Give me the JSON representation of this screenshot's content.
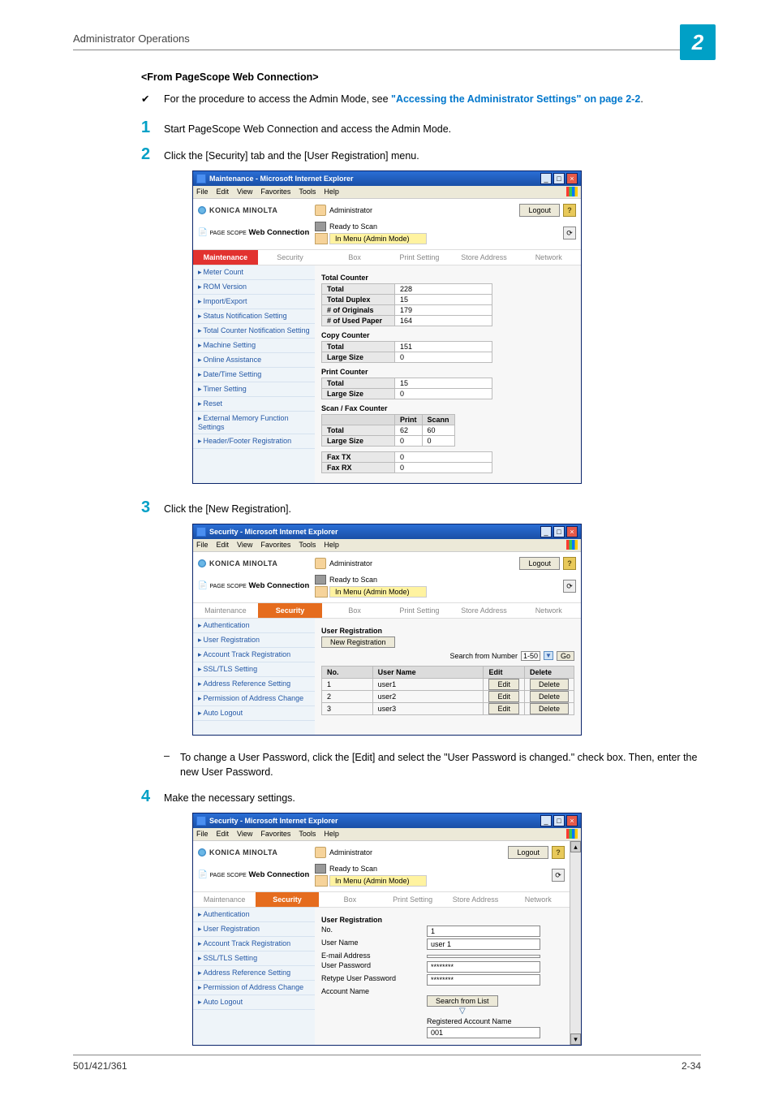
{
  "header": {
    "title": "Administrator Operations",
    "chip": "2"
  },
  "section": {
    "title": "<From PageScope Web Connection>"
  },
  "note": {
    "tick": "✔",
    "pre": "For the procedure to access the Admin Mode, see ",
    "link": "\"Accessing the Administrator Settings\" on page 2-2",
    "post": "."
  },
  "steps": {
    "s1": {
      "num": "1",
      "text": "Start PageScope Web Connection and access the Admin Mode."
    },
    "s2": {
      "num": "2",
      "text": "Click the [Security] tab and the [User Registration] menu."
    },
    "s3": {
      "num": "3",
      "text": "Click the [New Registration]."
    },
    "s3_sub": "To change a User Password, click the [Edit] and select the \"User Password is changed.\" check box. Then, enter the new User Password.",
    "s4": {
      "num": "4",
      "text": "Make the necessary settings."
    }
  },
  "win_common": {
    "brand": "KONICA MINOLTA",
    "role": "Administrator",
    "logout": "Logout",
    "wc": "Web Connection",
    "wc_small": "PAGE SCOPE",
    "status": "Ready to Scan",
    "mode": "In Menu (Admin Mode)",
    "menubar": {
      "file": "File",
      "edit": "Edit",
      "view": "View",
      "fav": "Favorites",
      "tools": "Tools",
      "help": "Help"
    },
    "tabs": {
      "maint": "Maintenance",
      "sec": "Security",
      "box": "Box",
      "print": "Print Setting",
      "store": "Store Address",
      "net": "Network"
    }
  },
  "win1": {
    "title": "Maintenance - Microsoft Internet Explorer",
    "side": [
      "Meter Count",
      "ROM Version",
      "Import/Export",
      "Status Notification Setting",
      "Total Counter Notification Setting",
      "Machine Setting",
      "Online Assistance",
      "Date/Time Setting",
      "Timer Setting",
      "Reset",
      "External Memory Function Settings",
      "Header/Footer Registration"
    ],
    "total_counter": {
      "heading": "Total Counter",
      "rows": [
        [
          "Total",
          "228"
        ],
        [
          "Total Duplex",
          "15"
        ],
        [
          "# of Originals",
          "179"
        ],
        [
          "# of Used Paper",
          "164"
        ]
      ]
    },
    "copy_counter": {
      "heading": "Copy Counter",
      "rows": [
        [
          "Total",
          "151"
        ],
        [
          "Large Size",
          "0"
        ]
      ]
    },
    "print_counter": {
      "heading": "Print Counter",
      "rows": [
        [
          "Total",
          "15"
        ],
        [
          "Large Size",
          "0"
        ]
      ]
    },
    "scanfax": {
      "heading": "Scan / Fax Counter",
      "cols": [
        "",
        "Print",
        "Scann"
      ],
      "rows": [
        [
          "Total",
          "62",
          "60"
        ],
        [
          "Large Size",
          "0",
          "0"
        ]
      ]
    },
    "faxtx": [
      "Fax TX",
      "0"
    ],
    "faxrx": [
      "Fax RX",
      "0"
    ]
  },
  "win2": {
    "title": "Security - Microsoft Internet Explorer",
    "side": [
      "Authentication",
      "User Registration",
      "Account Track Registration",
      "SSL/TLS Setting",
      "Address Reference Setting",
      "Permission of Address Change",
      "Auto Logout"
    ],
    "heading": "User Registration",
    "new_btn": "New Registration",
    "search_lbl": "Search from Number",
    "search_range": "1-50",
    "go": "Go",
    "table": {
      "cols": [
        "No.",
        "User Name",
        "Edit",
        "Delete"
      ],
      "rows": [
        [
          "1",
          "user1",
          "Edit",
          "Delete"
        ],
        [
          "2",
          "user2",
          "Edit",
          "Delete"
        ],
        [
          "3",
          "user3",
          "Edit",
          "Delete"
        ]
      ]
    }
  },
  "win3": {
    "title": "Security - Microsoft Internet Explorer",
    "side": [
      "Authentication",
      "User Registration",
      "Account Track Registration",
      "SSL/TLS Setting",
      "Address Reference Setting",
      "Permission of Address Change",
      "Auto Logout"
    ],
    "heading": "User Registration",
    "fields": {
      "no_lbl": "No.",
      "no_val": "1",
      "un_lbl": "User Name",
      "un_val": "user 1",
      "em_lbl": "E-mail Address",
      "em_val": "",
      "pw_lbl": "User Password",
      "pw_val": "********",
      "rpw_lbl": "Retype User Password",
      "rpw_val": "********",
      "an_lbl": "Account Name",
      "search_btn": "Search from List",
      "ran_lbl": "Registered Account Name",
      "ran_val": "001"
    }
  },
  "footer": {
    "left": "501/421/361",
    "right": "2-34"
  }
}
